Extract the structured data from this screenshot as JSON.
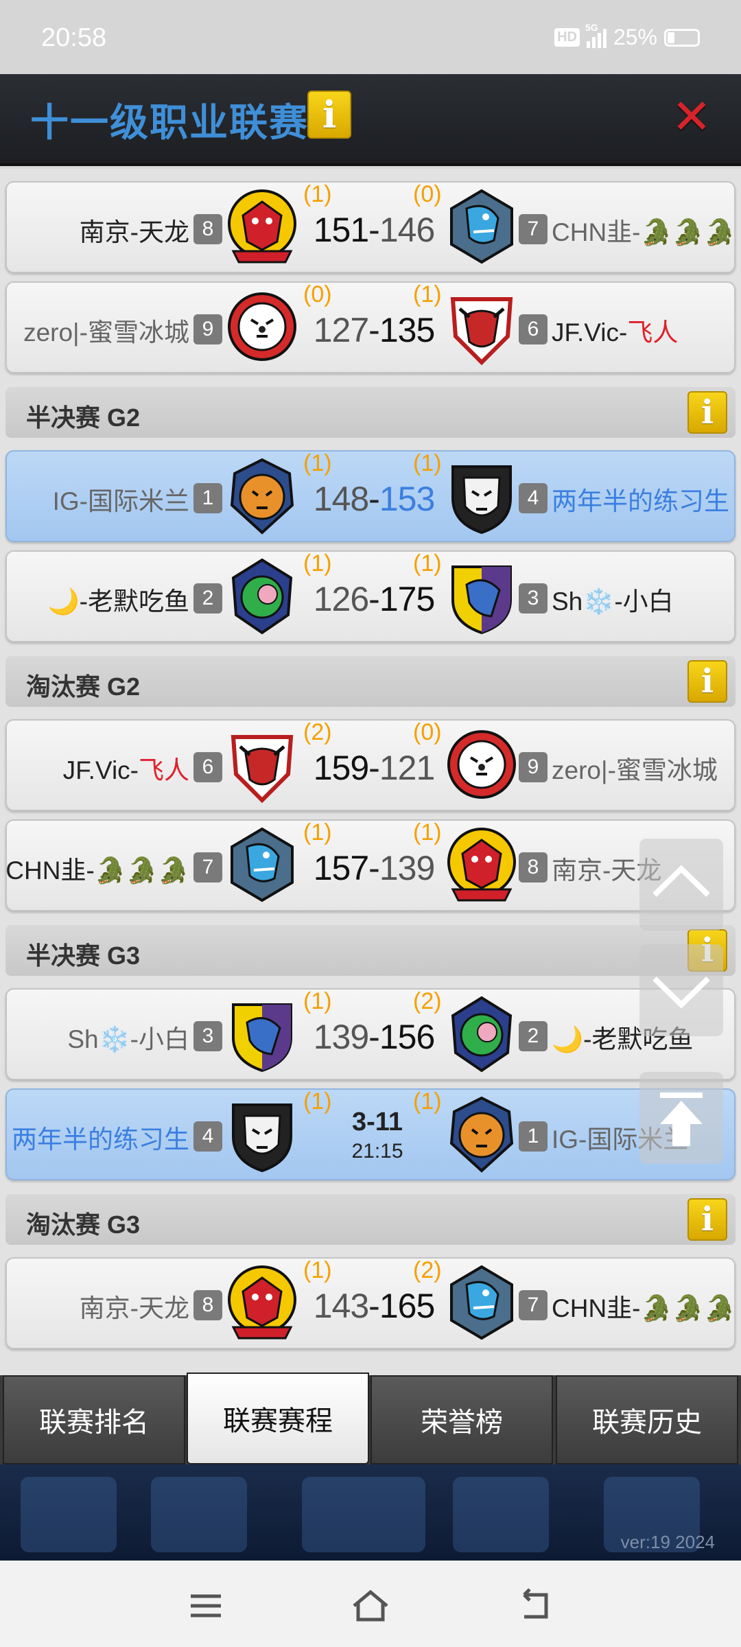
{
  "status": {
    "time": "20:58",
    "network": "5G",
    "hd": "HD",
    "battery": "25%"
  },
  "title": {
    "text": "十一级职业联赛",
    "info": "i",
    "close": "✕"
  },
  "matches_a": [
    {
      "left": {
        "name": "南京-天龙",
        "rank": "8",
        "wins": "(1)"
      },
      "score_l": "151",
      "score_r": "146",
      "right": {
        "name_pre": "CHN韭-",
        "name_post": "🐊🐊🐊",
        "rank": "7",
        "wins": "(0)"
      }
    },
    {
      "left": {
        "name": "zero|-蜜雪冰城",
        "rank": "9",
        "wins": "(0)"
      },
      "score_l": "127",
      "score_r": "135",
      "right": {
        "name_pre": "JF.Vic-",
        "name_post": "飞人",
        "rank": "6",
        "wins": "(1)"
      }
    }
  ],
  "sections": {
    "semi_g2": "半决赛 G2",
    "elim_g2": "淘汰赛 G2",
    "semi_g3": "半决赛 G3",
    "elim_g3": "淘汰赛 G3"
  },
  "semi_g2": [
    {
      "left": {
        "name": "IG-国际米兰",
        "rank": "1",
        "wins": "(1)"
      },
      "score_l": "148",
      "score_r": "153",
      "right": {
        "name": "两年半的练习生",
        "rank": "4",
        "wins": "(1)"
      }
    },
    {
      "left": {
        "name": "🌙-老默吃鱼",
        "rank": "2",
        "wins": "(1)"
      },
      "score_l": "126",
      "score_r": "175",
      "right": {
        "name": "Sh❄️-小白",
        "rank": "3",
        "wins": "(1)"
      }
    }
  ],
  "elim_g2": [
    {
      "left": {
        "name_pre": "JF.Vic-",
        "name_post": "飞人",
        "rank": "6",
        "wins": "(2)"
      },
      "score_l": "159",
      "score_r": "121",
      "right": {
        "name": "zero|-蜜雪冰城",
        "rank": "9",
        "wins": "(0)"
      }
    },
    {
      "left": {
        "name": "CHN韭-🐊🐊🐊",
        "rank": "7",
        "wins": "(1)"
      },
      "score_l": "157",
      "score_r": "139",
      "right": {
        "name": "南京-天龙",
        "rank": "8",
        "wins": "(1)"
      }
    }
  ],
  "semi_g3": [
    {
      "left": {
        "name": "Sh❄️-小白",
        "rank": "3",
        "wins": "(1)"
      },
      "score_l": "139",
      "score_r": "156",
      "right": {
        "name": "🌙-老默吃鱼",
        "rank": "2",
        "wins": "(2)"
      }
    },
    {
      "left": {
        "name": "两年半的练习生",
        "rank": "4",
        "wins": "(1)"
      },
      "date": "3-11",
      "time": "21:15",
      "right": {
        "name": "IG-国际米兰",
        "rank": "1",
        "wins": "(1)"
      }
    }
  ],
  "elim_g3": [
    {
      "left": {
        "name": "南京-天龙",
        "rank": "8",
        "wins": "(1)"
      },
      "score_l": "143",
      "score_r": "165",
      "right": {
        "name": "CHN韭-🐊🐊🐊",
        "rank": "7",
        "wins": "(2)"
      }
    }
  ],
  "sep": "-",
  "tabs": [
    "联赛排名",
    "联赛赛程",
    "荣誉榜",
    "联赛历史"
  ],
  "version": "ver:19  2024",
  "colors": {
    "accent": "#3f8fd8",
    "wins": "#f5a000",
    "highlight": "#a3c7f0",
    "close": "#d8232a"
  }
}
